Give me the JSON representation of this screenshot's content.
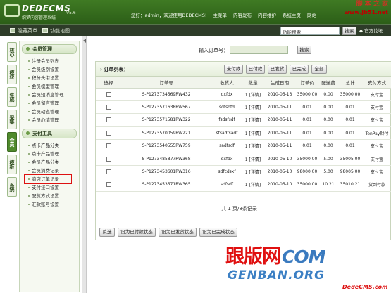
{
  "header": {
    "logo_main": "DEDECMS",
    "logo_version": "V5.6",
    "logo_sub": "织梦内容管理系统",
    "welcome": "您好：admin，欢迎使用DEDECMS!",
    "nav": [
      "主菜单",
      "内容发布",
      "内容维护",
      "系统主页",
      "网站"
    ],
    "site_watermark_1": "脚 本 之 家",
    "site_watermark_2": "www.Jb51.net"
  },
  "toolbar": {
    "hide_menu": "隐藏菜单",
    "function_map": "功能地图",
    "search_value": "功能搜索",
    "search_button": "搜索",
    "home_link": "◆ 官方论坛"
  },
  "left_tabs": [
    "核心",
    "模块",
    "生成",
    "采集",
    "会员",
    "模板",
    "系统"
  ],
  "left_tabs_active": "会员",
  "sidebar": {
    "sections": [
      {
        "title": "会员管理",
        "items": [
          "注册会员列表",
          "会员级别设置",
          "积分头衔设置",
          "会员模型管理",
          "会员短消息管理",
          "会员留言管理",
          "会员动态管理",
          "会员心情管理"
        ]
      },
      {
        "title": "支付工具",
        "items": [
          "点卡产品分类",
          "点卡产品管理",
          "会员产品分类",
          "会员消费记录",
          "商店订单记录",
          "支付接口设置",
          "配货方式设置",
          "汇款账号设置"
        ]
      }
    ],
    "highlighted_item": "商店订单记录"
  },
  "main": {
    "query_label": "输入订单号：",
    "query_value": "",
    "query_button": "搜索",
    "panel_title": "› 订单列表：",
    "filters": [
      "未付款",
      "已付款",
      "已发货",
      "已完成",
      "全部"
    ],
    "columns": [
      "选择",
      "订单号",
      "收货人",
      "数量",
      "生成日期",
      "订单价",
      "配送费",
      "总计",
      "支付方式"
    ],
    "rows": [
      [
        "S-P1273734569RW432",
        "dxfdx",
        "1 [详情]",
        "2010-05-13",
        "35000.00",
        "0.00",
        "35000.00",
        "支付宝"
      ],
      [
        "S-P1273571638RW567",
        "sdfsdfd",
        "1 [详情]",
        "2010-05-11",
        "0.01",
        "0.00",
        "0.01",
        "支付宝"
      ],
      [
        "S-P1273571581RW322",
        "fsdsfsdf",
        "1 [详情]",
        "2010-05-11",
        "0.01",
        "0.00",
        "0.01",
        "支付宝"
      ],
      [
        "S-P1273570059RW221",
        "sfsadfsadf",
        "1 [详情]",
        "2010-05-11",
        "0.01",
        "0.00",
        "0.01",
        "TenPay财付"
      ],
      [
        "S-P1273540555RW759",
        "sadfsdf",
        "1 [详情]",
        "2010-05-11",
        "0.01",
        "0.00",
        "0.01",
        "支付宝"
      ],
      [
        "S-P1273485877RW368",
        "dxfdx",
        "1 [详情]",
        "2010-05-10",
        "35000.00",
        "5.00",
        "35005.00",
        "支付宝"
      ],
      [
        "S-P1273453601RW316",
        "sdfcdsxf",
        "1 [详情]",
        "2010-05-10",
        "98000.00",
        "5.00",
        "98005.00",
        "支付宝"
      ],
      [
        "S-P1273453571RW365",
        "sdfsdf",
        "1 [详情]",
        "2010-05-10",
        "35000.00",
        "10.21",
        "35010.21",
        "货到付款"
      ]
    ],
    "actions": [
      "反选",
      "设为已付款状态",
      "设为已发货状态",
      "设为已完成状态"
    ],
    "pagination": "共 1 页/8条记录"
  },
  "watermark": {
    "line1_a": "跟版",
    "line1_b": "网",
    "line1_c": "COM",
    "line2": "GENBAN.ORG",
    "line3": "DedeCMS.com"
  }
}
